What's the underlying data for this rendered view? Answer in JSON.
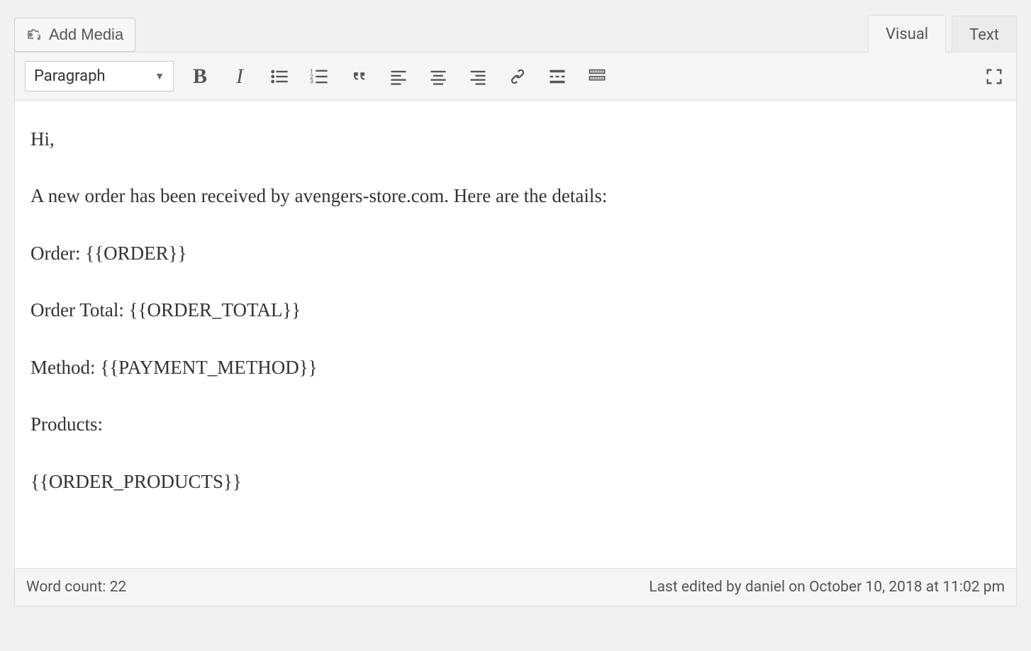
{
  "media_button": {
    "label": "Add Media"
  },
  "tabs": {
    "visual": "Visual",
    "text": "Text",
    "active": "visual"
  },
  "format_selector": {
    "current": "Paragraph"
  },
  "toolbar": {
    "bold_glyph": "B",
    "italic_glyph": "I"
  },
  "content": {
    "p1": "Hi,",
    "p2": "A new order has been received by avengers-store.com. Here are the details:",
    "p3": "Order: {{ORDER}}",
    "p4": "Order Total: {{ORDER_TOTAL}}",
    "p5": "Method: {{PAYMENT_METHOD}}",
    "p6": "Products:",
    "p7": "{{ORDER_PRODUCTS}}"
  },
  "status": {
    "word_count_label": "Word count: 22",
    "last_edited": "Last edited by daniel on October 10, 2018 at 11:02 pm"
  }
}
